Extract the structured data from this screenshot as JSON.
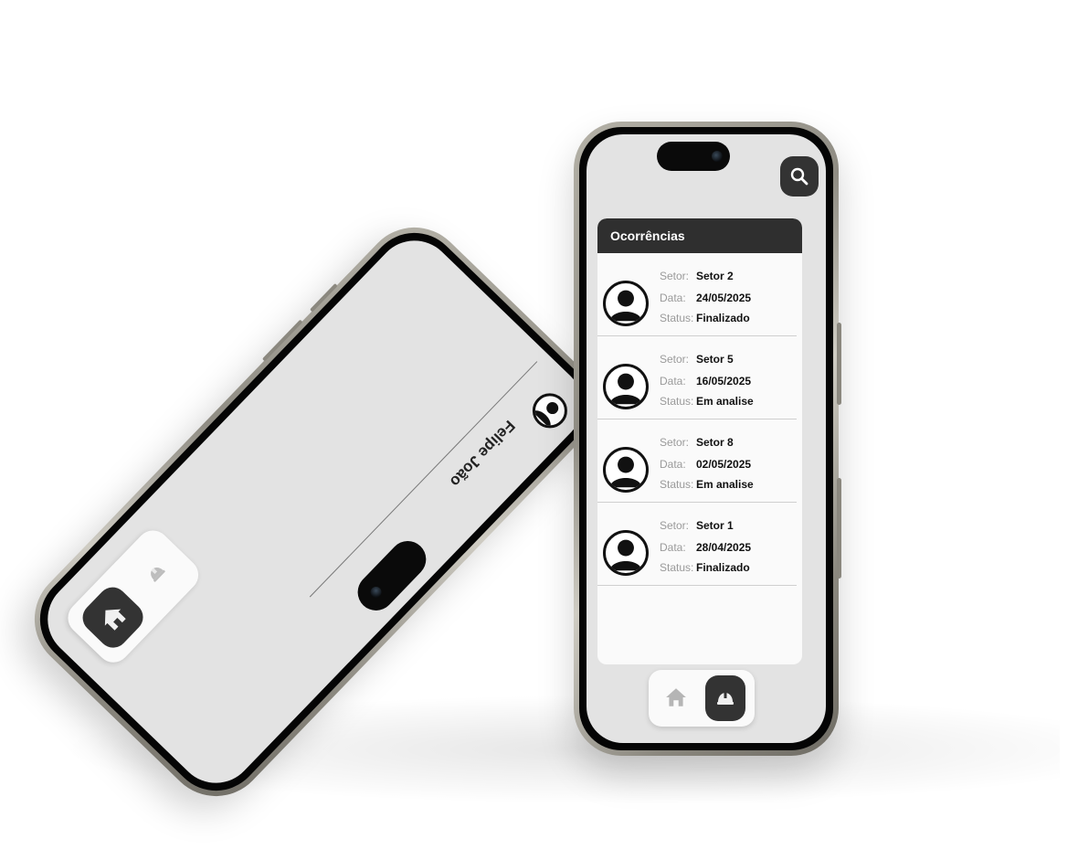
{
  "left_phone": {
    "profile_name": "Felipe João"
  },
  "right_phone": {
    "section_title": "Ocorrências",
    "field_labels": {
      "sector": "Setor:",
      "date": "Data:",
      "status": "Status:"
    },
    "occurrences": [
      {
        "sector": "Setor 2",
        "date": "24/05/2025",
        "status": "Finalizado"
      },
      {
        "sector": "Setor 5",
        "date": "16/05/2025",
        "status": "Em analise"
      },
      {
        "sector": "Setor 8",
        "date": "02/05/2025",
        "status": "Em analise"
      },
      {
        "sector": "Setor 1",
        "date": "28/04/2025",
        "status": "Finalizado"
      }
    ]
  },
  "icons": {
    "search": "search-icon",
    "home": "home-icon",
    "helmet": "helmet-icon",
    "avatar": "user-avatar-icon"
  },
  "colors": {
    "dark_ui": "#333333",
    "screen_bg": "#e3e3e3",
    "card_bg": "#fafafa",
    "label_gray": "#9a9a9a"
  }
}
